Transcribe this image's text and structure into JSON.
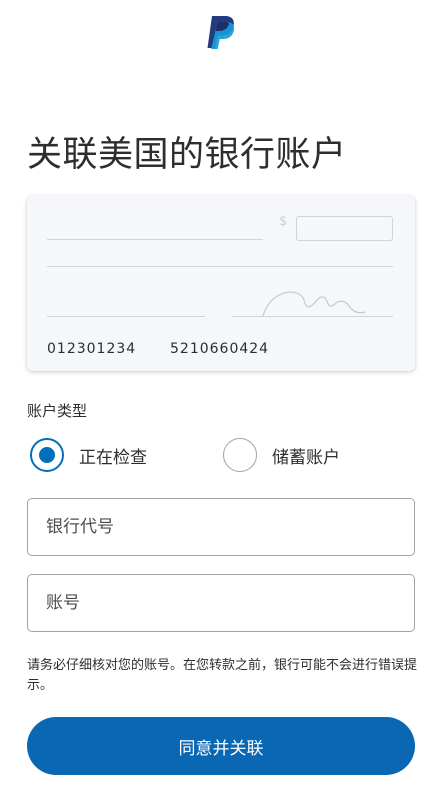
{
  "brand": {
    "logo_icon": "paypal-logo-icon",
    "accent": "#0070ba"
  },
  "page_title": "关联美国的银行账户",
  "check_sample": {
    "currency_symbol": "$",
    "routing_number": "012301234",
    "account_number": "5210660424"
  },
  "account_type": {
    "label": "账户类型",
    "options": [
      {
        "label": "正在检查",
        "selected": true
      },
      {
        "label": "储蓄账户",
        "selected": false
      }
    ]
  },
  "fields": {
    "routing": {
      "placeholder": "银行代号",
      "value": ""
    },
    "account": {
      "placeholder": "账号",
      "value": ""
    }
  },
  "notice": "请务必仔细核对您的账号。在您转款之前，银行可能不会进行错误提示。",
  "submit_label": "同意并关联"
}
